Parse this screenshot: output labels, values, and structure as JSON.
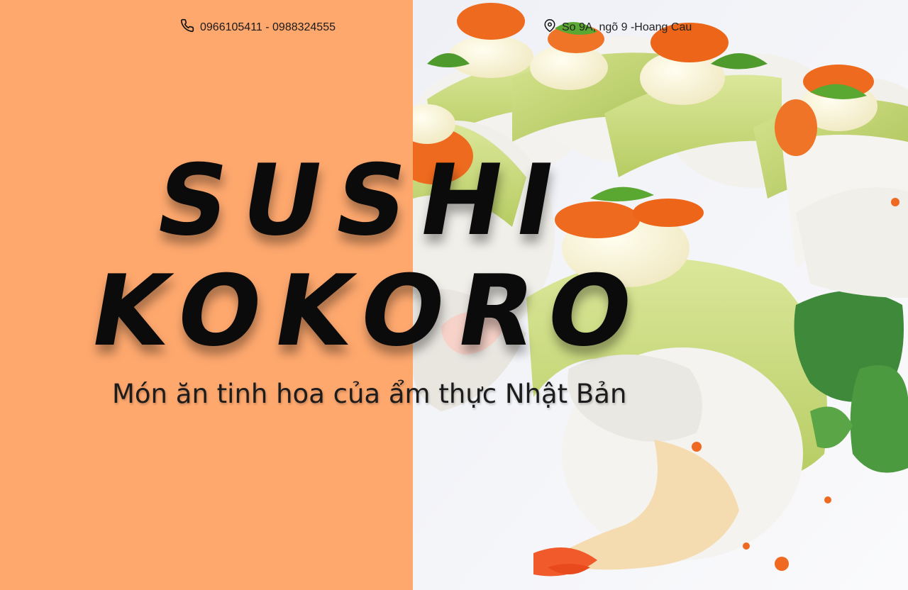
{
  "hero": {
    "phone": "0966105411 - 0988324555",
    "address": "So 9A, ngõ 9 -Hoang Cau",
    "title_line1": "SUSHI",
    "title_line2": "KOKORO",
    "tagline": "Món ăn tinh hoa của ẩm thực Nhật Bản"
  },
  "colors": {
    "left_panel": "#fea86e",
    "title": "#0b0b0b",
    "avocado": "#cfe08a",
    "roe": "#ee6a1e",
    "rice": "#f7f7fa"
  },
  "icons": {
    "phone": "phone-icon",
    "address": "map-pin-icon"
  }
}
